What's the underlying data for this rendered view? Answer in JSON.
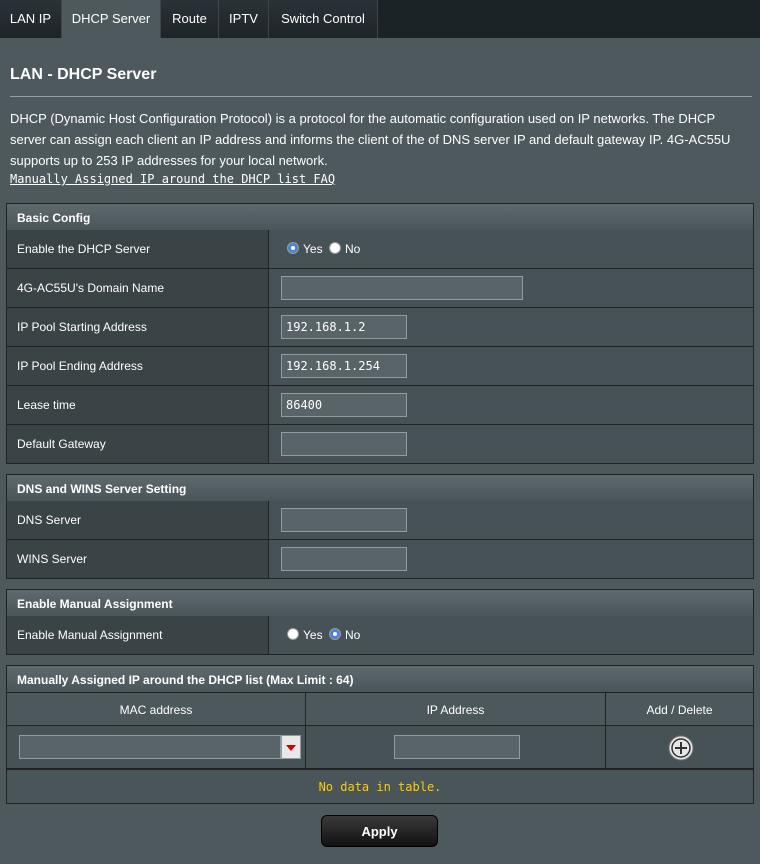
{
  "tabs": [
    {
      "label": "LAN IP"
    },
    {
      "label": "DHCP Server"
    },
    {
      "label": "Route"
    },
    {
      "label": "IPTV"
    },
    {
      "label": "Switch Control"
    }
  ],
  "title": "LAN - DHCP Server",
  "description_lines": [
    "DHCP (Dynamic Host Configuration Protocol) is a protocol for the automatic configuration used on IP networks. The DHCP",
    "server can assign each client an IP address and informs the client of the of DNS server IP and default gateway IP. 4G-AC55U",
    "supports up to 253 IP addresses for your local network."
  ],
  "faq_link": "Manually Assigned IP around the DHCP list FAQ",
  "basic": {
    "header": "Basic Config",
    "enable_label": "Enable the DHCP Server",
    "enable_value": "Yes",
    "yes": "Yes",
    "no": "No",
    "domain_label": "4G-AC55U's Domain Name",
    "domain_value": "",
    "start_label": "IP Pool Starting Address",
    "start_value": "192.168.1.2",
    "end_label": "IP Pool Ending Address",
    "end_value": "192.168.1.254",
    "lease_label": "Lease time",
    "lease_value": "86400",
    "gateway_label": "Default Gateway",
    "gateway_value": ""
  },
  "dns": {
    "header": "DNS and WINS Server Setting",
    "dns_label": "DNS Server",
    "dns_value": "",
    "wins_label": "WINS Server",
    "wins_value": ""
  },
  "manual": {
    "header": "Enable Manual Assignment",
    "label": "Enable Manual Assignment",
    "value": "No",
    "yes": "Yes",
    "no": "No"
  },
  "list": {
    "header": "Manually Assigned IP around the DHCP list (Max Limit : 64)",
    "col_mac": "MAC address",
    "col_ip": "IP Address",
    "col_action": "Add / Delete",
    "mac_value": "",
    "ip_value": "",
    "empty_text": "No data in table."
  },
  "apply_label": "Apply",
  "icons": {
    "add": "add-circle-icon",
    "dropdown": "dropdown-arrow-icon"
  },
  "colors": {
    "accent": "#4a84e0",
    "nodata": "#ffcc00",
    "background": "#4d595d"
  }
}
